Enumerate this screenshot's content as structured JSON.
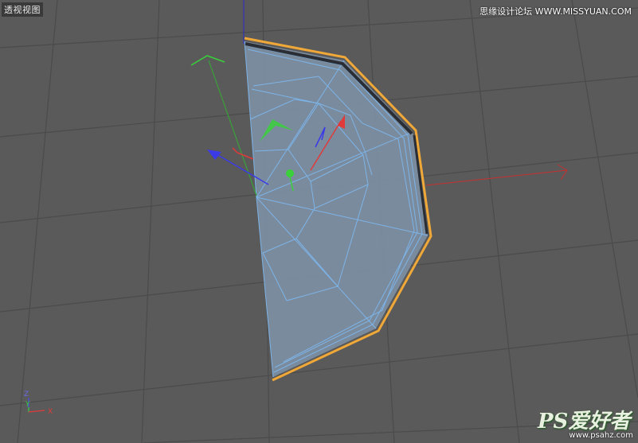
{
  "viewport": {
    "view_label": "透视视图",
    "background_color": "#5a5a5a",
    "grid_color": "#4a4a4a"
  },
  "object": {
    "face_color": "#7e8fa4",
    "wireframe_color": "#7cb4e8",
    "selection_outline_color": "#f0a838"
  },
  "gizmo": {
    "x_color": "#e03a3a",
    "y_color": "#3ad03a",
    "z_color": "#3a3ae8"
  },
  "axis_triad": {
    "z_label": "Z",
    "y_label": "Y",
    "x_label": "X"
  },
  "watermark": {
    "top_text": "思缘设计论坛 WWW.MISSYUAN.COM",
    "bottom_logo": "PS爱好者",
    "bottom_url": "www.psahz.com"
  }
}
